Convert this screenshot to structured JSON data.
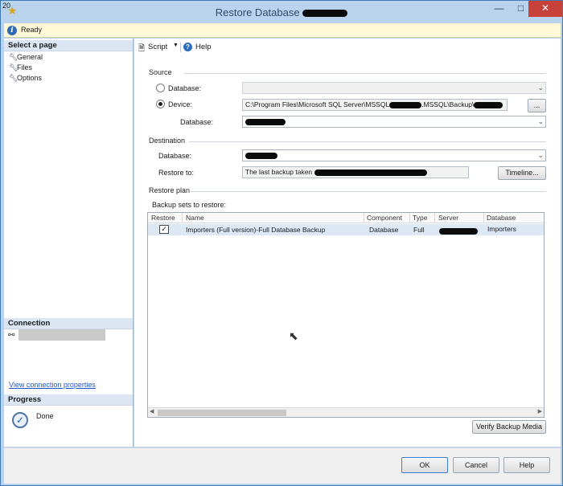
{
  "window": {
    "tab_number": "20",
    "title": "Restore Database",
    "controls": {
      "minimize": "—",
      "maximize": "□",
      "close": "✕"
    }
  },
  "status": {
    "text": "Ready",
    "icon": "info-icon"
  },
  "left": {
    "select_page": "Select a page",
    "pages": [
      "General",
      "Files",
      "Options"
    ],
    "connection_header": "Connection",
    "connection_link": "View connection properties",
    "progress_header": "Progress",
    "progress_status": "Done"
  },
  "toolbar": {
    "script": "Script",
    "help": "Help"
  },
  "source": {
    "label": "Source",
    "database_radio": "Database:",
    "device_radio": "Device:",
    "device_path_prefix": "C:\\Program Files\\Microsoft SQL Server\\MSSQL",
    "device_path_mid": ".MSSQL\\Backup\\",
    "browse_button": "...",
    "database_label": "Database:"
  },
  "destination": {
    "label": "Destination",
    "database_label": "Database:",
    "restore_to_label": "Restore to:",
    "restore_to_value": "The last backup taken",
    "timeline_button": "Timeline..."
  },
  "restore_plan": {
    "label": "Restore plan",
    "backup_sets_label": "Backup sets to restore:",
    "columns": [
      "Restore",
      "Name",
      "Component",
      "Type",
      "Server",
      "Database"
    ],
    "rows": [
      {
        "restore": "✓",
        "name": "Importers (Full version)-Full Database Backup",
        "component": "Database",
        "type": "Full",
        "server": "",
        "database": "Importers"
      }
    ],
    "verify_button": "Verify Backup Media"
  },
  "footer": {
    "ok": "OK",
    "cancel": "Cancel",
    "help": "Help"
  }
}
